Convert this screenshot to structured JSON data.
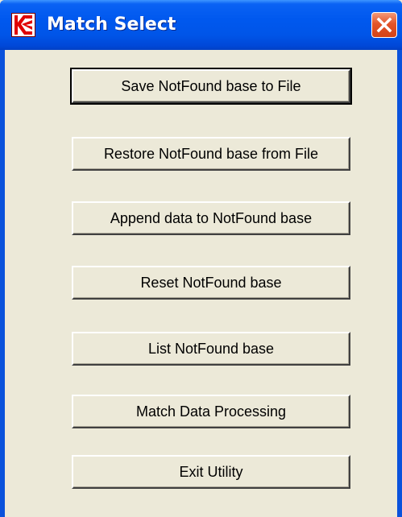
{
  "window": {
    "title": "Match Select",
    "icon": "kinetic-logo-icon",
    "close_icon": "close-icon",
    "colors": {
      "titlebar": "#0055e8",
      "client_background": "#ece9d8",
      "close_button": "#e2542a",
      "logo_red": "#e00000"
    }
  },
  "buttons": [
    {
      "id": "save",
      "label": "Save NotFound base to File",
      "default": true
    },
    {
      "id": "restore",
      "label": "Restore NotFound base from File",
      "default": false
    },
    {
      "id": "append",
      "label": "Append data to NotFound base",
      "default": false
    },
    {
      "id": "reset",
      "label": "Reset NotFound base",
      "default": false
    },
    {
      "id": "list",
      "label": "List NotFound base",
      "default": false
    },
    {
      "id": "match",
      "label": "Match Data Processing",
      "default": false
    },
    {
      "id": "exit",
      "label": "Exit Utility",
      "default": false
    }
  ]
}
